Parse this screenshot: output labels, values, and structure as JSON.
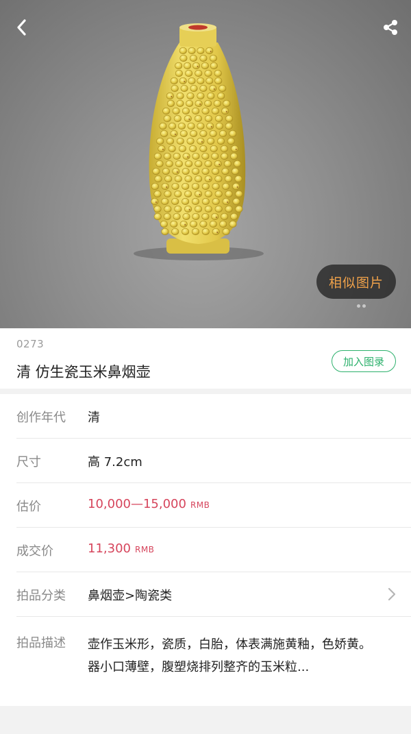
{
  "hero": {
    "back_icon": "chevron-left-icon",
    "share_icon": "share-icon",
    "similar_button": "相似图片"
  },
  "lot": {
    "number": "0273",
    "title": "清 仿生瓷玉米鼻烟壶",
    "add_catalog_button": "加入图录"
  },
  "details": {
    "era": {
      "label": "创作年代",
      "value": "清"
    },
    "size": {
      "label": "尺寸",
      "value": "高 7.2cm"
    },
    "estimate": {
      "label": "估价",
      "value": "10,000—15,000",
      "unit": "RMB"
    },
    "sold": {
      "label": "成交价",
      "value": "11,300",
      "unit": "RMB"
    },
    "category": {
      "label": "拍品分类",
      "value": "鼻烟壶>陶瓷类"
    },
    "description": {
      "label": "拍品描述",
      "value": "壶作玉米形，瓷质，白胎，体表满施黄釉，色娇黄。器小口薄壁，腹塑烧排列整齐的玉米粒..."
    }
  },
  "colors": {
    "accent_green": "#2bb06b",
    "price_red": "#d6455c",
    "similar_text": "#f0a24a"
  }
}
